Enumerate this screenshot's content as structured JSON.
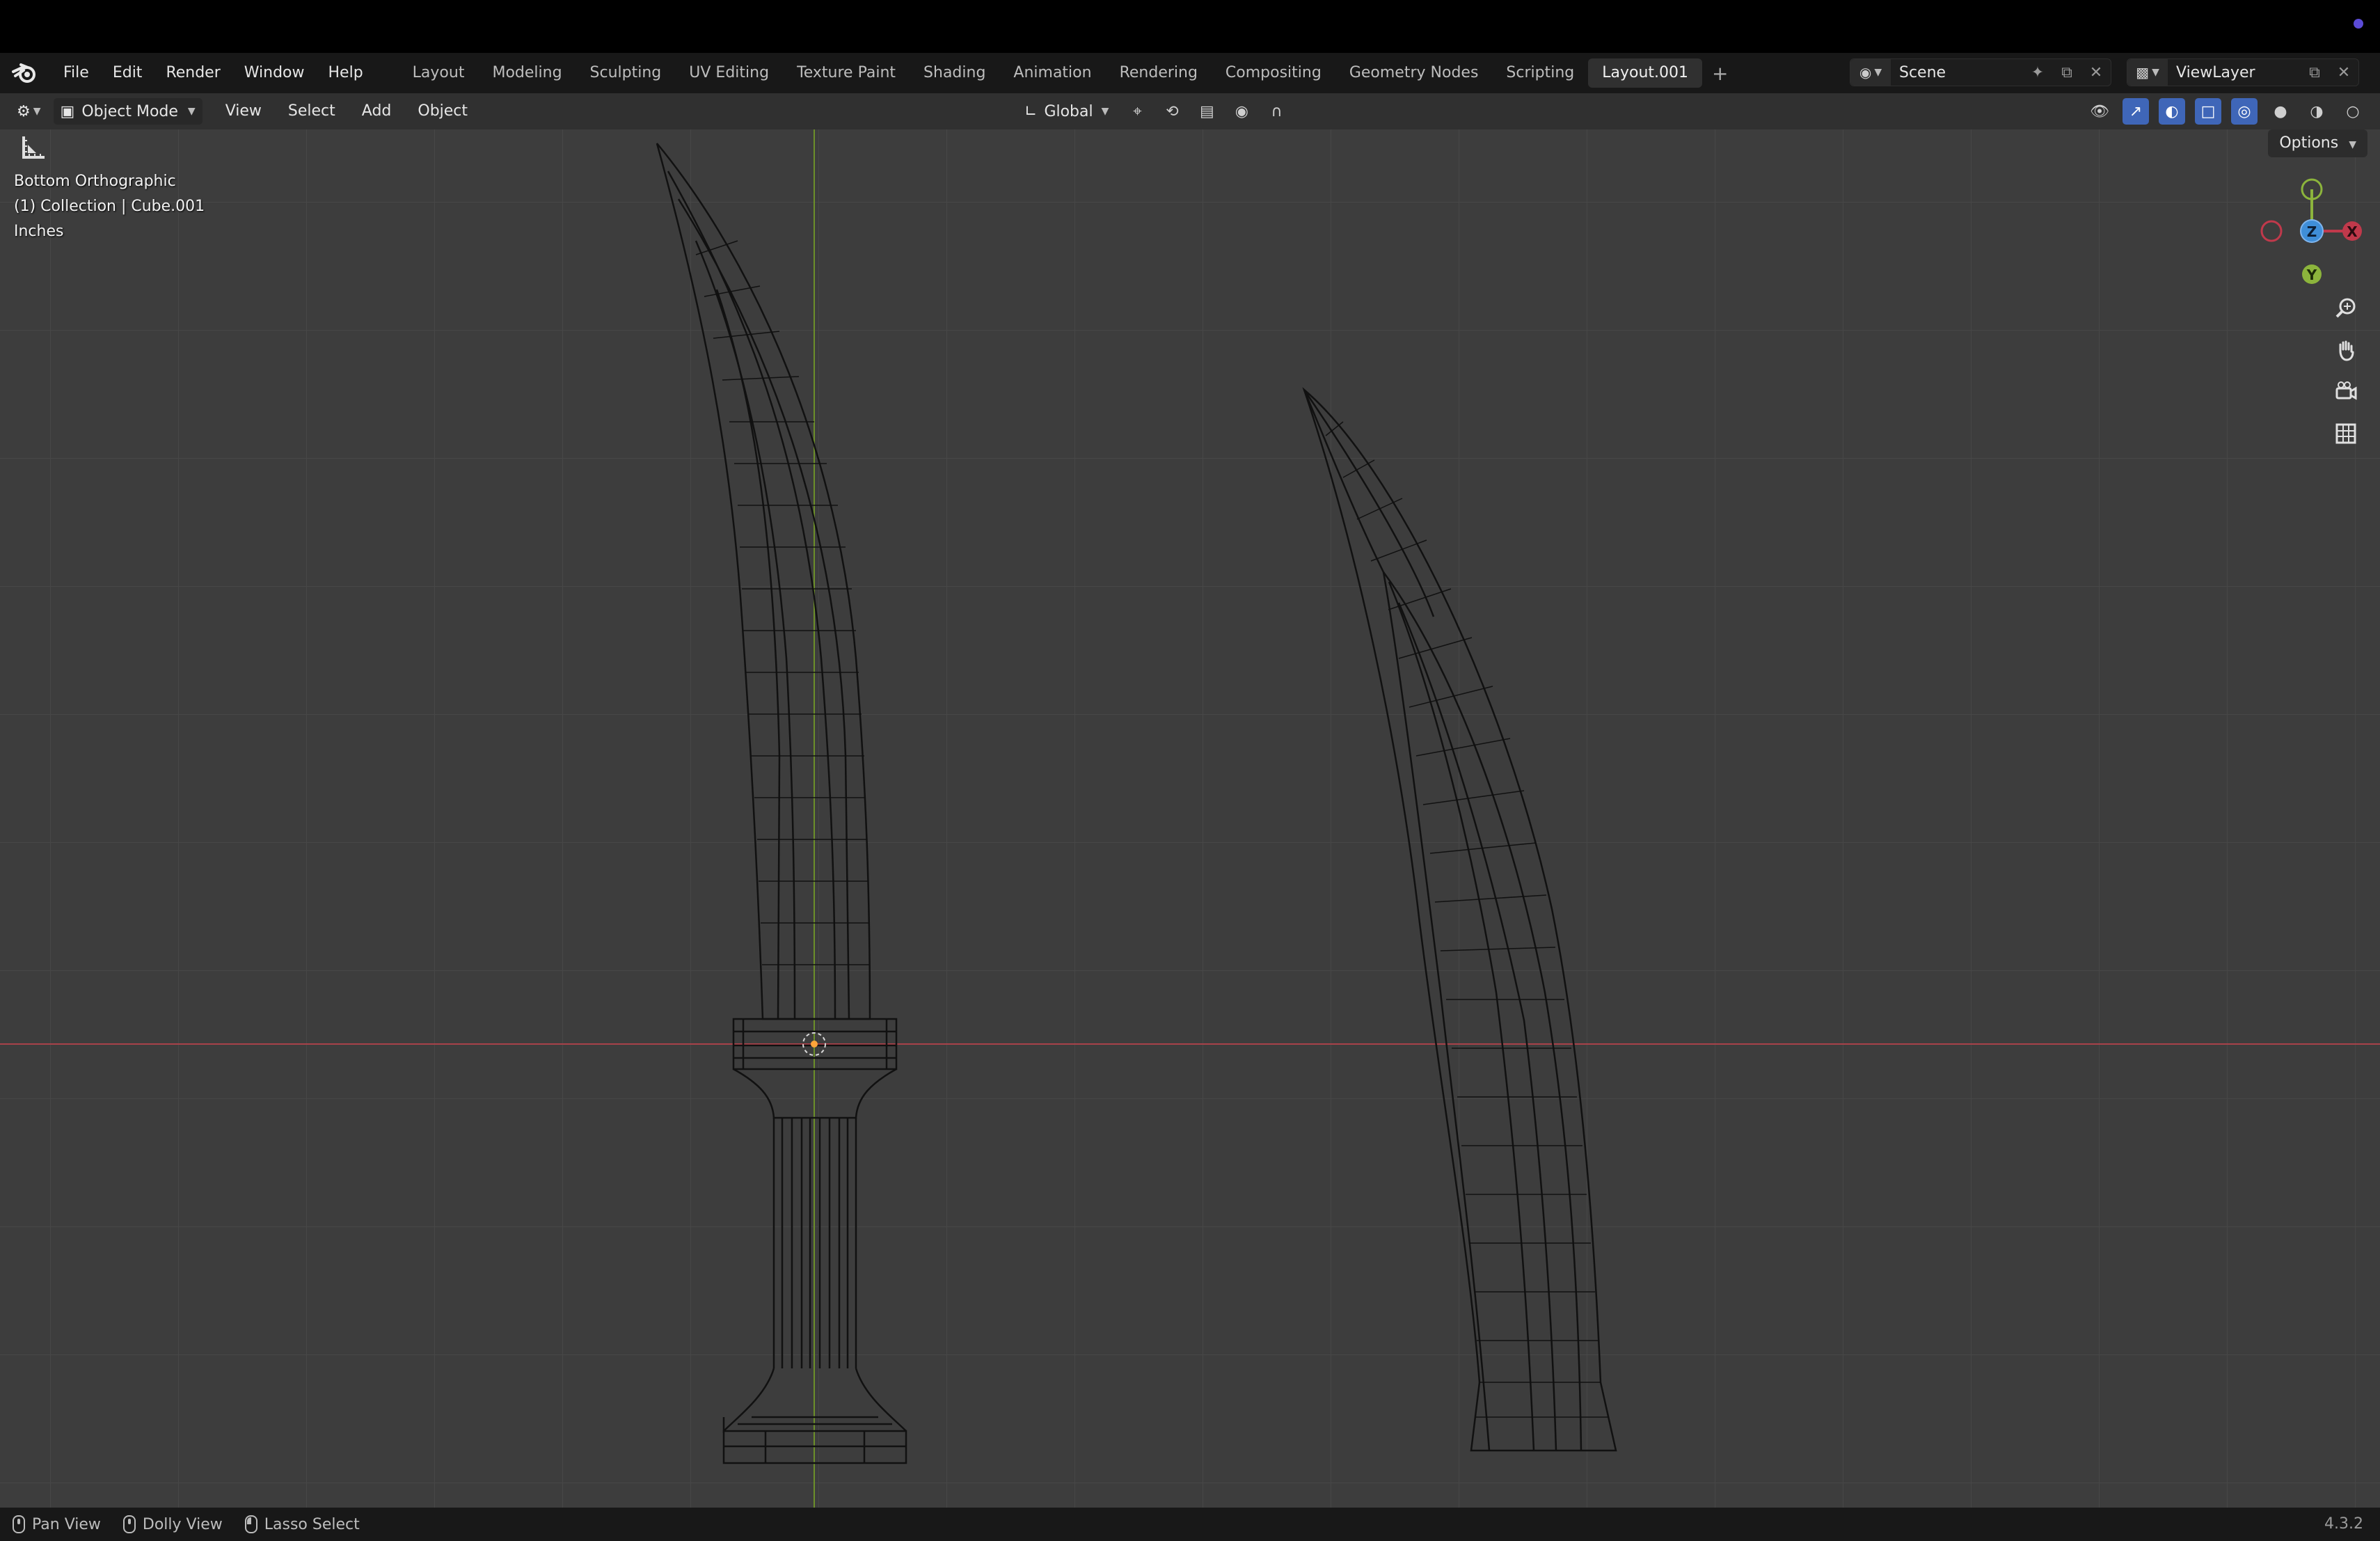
{
  "menubar": {
    "items": [
      "File",
      "Edit",
      "Render",
      "Window",
      "Help"
    ]
  },
  "workspaces": {
    "tabs": [
      "Layout",
      "Modeling",
      "Sculpting",
      "UV Editing",
      "Texture Paint",
      "Shading",
      "Animation",
      "Rendering",
      "Compositing",
      "Geometry Nodes",
      "Scripting",
      "Layout.001"
    ],
    "active": "Layout.001",
    "add_label": "+"
  },
  "scene": {
    "name": "Scene"
  },
  "view_layer": {
    "name": "ViewLayer"
  },
  "viewport_header": {
    "mode": "Object Mode",
    "menus": [
      "View",
      "Select",
      "Add",
      "Object"
    ],
    "transform_orientation": "Global"
  },
  "viewport": {
    "view_name": "Bottom Orthographic",
    "collection_info": "(1) Collection | Cube.001",
    "units": "Inches",
    "options_label": "Options",
    "gizmo_axes": {
      "x": "X",
      "y": "Y",
      "z": "Z"
    },
    "colors": {
      "x_axis": "#c0394b",
      "y_axis": "#8cb43c",
      "z_axis": "#3f8ed8",
      "background": "#3d3d3d"
    }
  },
  "statusbar": {
    "items": [
      "Pan View",
      "Dolly View",
      "Lasso Select"
    ],
    "version": "4.3.2"
  },
  "icons": [
    "blender-logo-icon",
    "editor-type-icon",
    "object-mode-icon",
    "orientation-icon",
    "pivot-icon",
    "snap-icon",
    "proportional-icon",
    "visibility-icon",
    "gizmo-icon",
    "overlay-icon",
    "xray-icon",
    "wireframe-icon",
    "solid-icon",
    "material-icon",
    "rendered-icon",
    "zoom-icon",
    "hand-icon",
    "camera-icon",
    "grid-icon",
    "measure-tool-icon"
  ]
}
